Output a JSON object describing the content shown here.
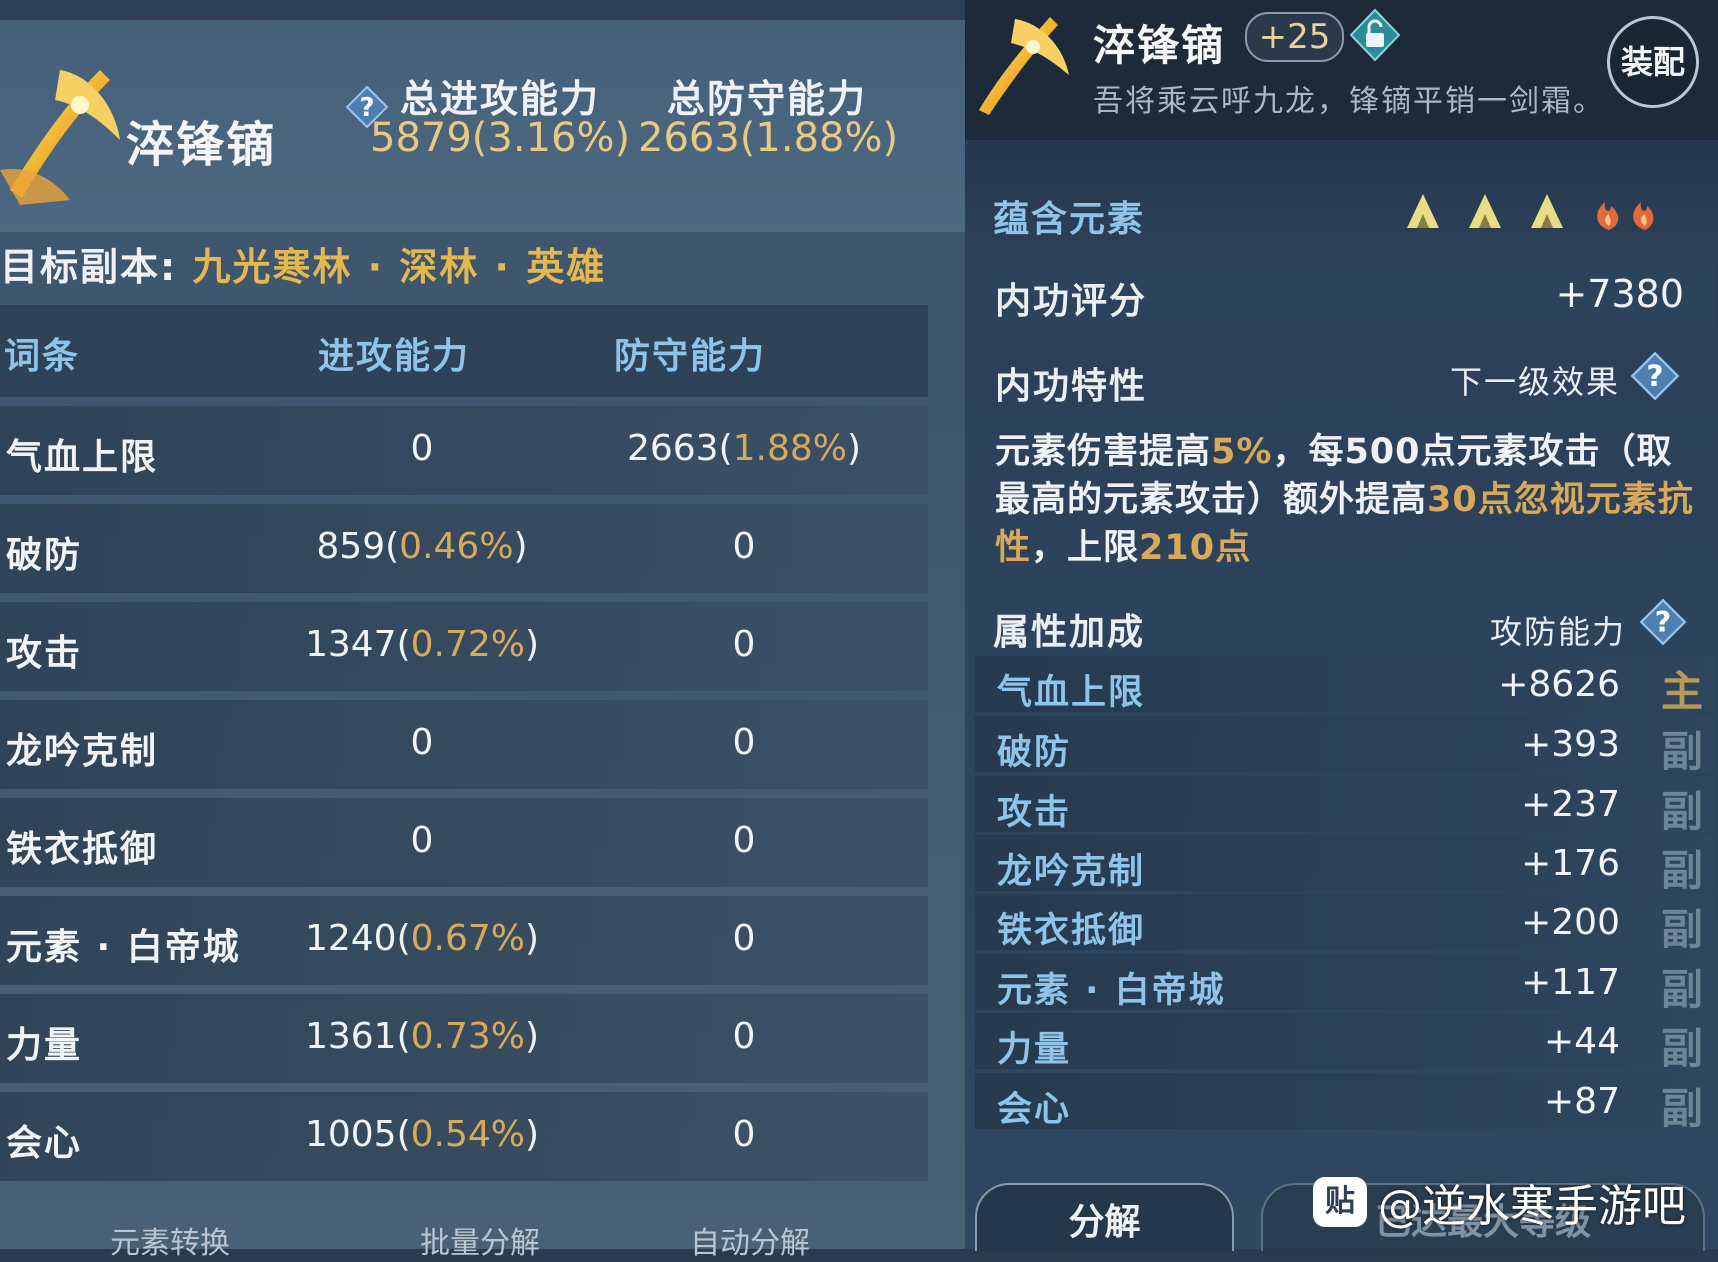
{
  "left_panel": {
    "weapon_name": "淬锋镝",
    "total_attack_label": "总进攻能力",
    "total_attack_value": "5879(3.16%)",
    "total_defense_label": "总防守能力",
    "total_defense_value": "2663(1.88%)",
    "target_label": "目标副本:",
    "target_value": "九光寒林 · 深林 · 英雄",
    "table": {
      "headers": [
        "词条",
        "进攻能力",
        "防守能力"
      ],
      "rows": [
        {
          "name": "气血上限",
          "atk": "0",
          "atk_pct": "",
          "def": "2663",
          "def_pct": "1.88%"
        },
        {
          "name": "破防",
          "atk": "859",
          "atk_pct": "0.46%",
          "def": "0",
          "def_pct": ""
        },
        {
          "name": "攻击",
          "atk": "1347",
          "atk_pct": "0.72%",
          "def": "0",
          "def_pct": ""
        },
        {
          "name": "龙吟克制",
          "atk": "0",
          "atk_pct": "",
          "def": "0",
          "def_pct": ""
        },
        {
          "name": "铁衣抵御",
          "atk": "0",
          "atk_pct": "",
          "def": "0",
          "def_pct": ""
        },
        {
          "name": "元素 · 白帝城",
          "atk": "1240",
          "atk_pct": "0.67%",
          "def": "0",
          "def_pct": ""
        },
        {
          "name": "力量",
          "atk": "1361",
          "atk_pct": "0.73%",
          "def": "0",
          "def_pct": ""
        },
        {
          "name": "会心",
          "atk": "1005",
          "atk_pct": "0.54%",
          "def": "0",
          "def_pct": ""
        }
      ]
    },
    "bottom_buttons": [
      "元素转换",
      "批量分解",
      "自动分解"
    ]
  },
  "right_panel": {
    "weapon_name": "淬锋镝",
    "enhance_level": "+25",
    "description": "吾将乘云呼九龙，锋镝平销一剑霜。",
    "equip_label": "装配",
    "elements_label": "蕴含元素",
    "element_icons": [
      "earth-triangle-icon",
      "earth-triangle-icon",
      "earth-triangle-icon",
      "fire-flame-icon",
      "fire-flame-icon"
    ],
    "internal_score_label": "内功评分",
    "internal_score_value": "+7380",
    "trait_label": "内功特性",
    "next_effect_label": "下一级效果",
    "trait_text": {
      "p1": "元素伤害提高",
      "p1_gold": "5%",
      "p2": "，每500点元素攻击（取最高的元素攻击）额外提高",
      "p2_gold": "30点忽视元素抗性",
      "p3": "，上限",
      "p3_gold": "210点"
    },
    "attr_label": "属性加成",
    "attr_right_label": "攻防能力",
    "attributes": [
      {
        "name": "气血上限",
        "value": "+8626",
        "tag": "主"
      },
      {
        "name": "破防",
        "value": "+393",
        "tag": "副"
      },
      {
        "name": "攻击",
        "value": "+237",
        "tag": "副"
      },
      {
        "name": "龙吟克制",
        "value": "+176",
        "tag": "副"
      },
      {
        "name": "铁衣抵御",
        "value": "+200",
        "tag": "副"
      },
      {
        "name": "元素 · 白帝城",
        "value": "+117",
        "tag": "副"
      },
      {
        "name": "力量",
        "value": "+44",
        "tag": "副"
      },
      {
        "name": "会心",
        "value": "+87",
        "tag": "副"
      }
    ],
    "decompose_label": "分解",
    "max_level_label": "已达最大等级"
  },
  "watermark": {
    "logo": "贴",
    "text": "@逆水寒手游吧"
  },
  "colors": {
    "gold": "#d9a95a",
    "blue_label": "#8fc3e8",
    "earth": "#e8dc86",
    "fire": "#e06a3c"
  }
}
